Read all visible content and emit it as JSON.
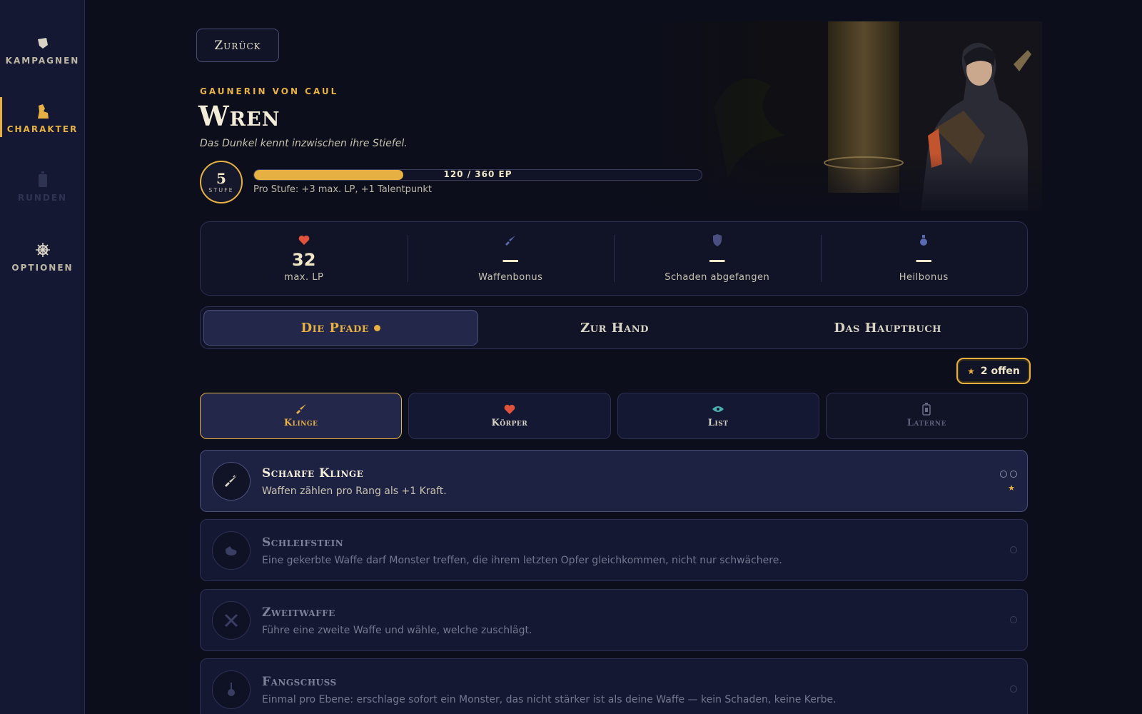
{
  "sidebar": {
    "items": [
      {
        "label": "KAMPAGNEN",
        "icon": "cards-icon"
      },
      {
        "label": "CHARAKTER",
        "icon": "character-icon"
      },
      {
        "label": "RUNDEN",
        "icon": "lantern-icon"
      },
      {
        "label": "OPTIONEN",
        "icon": "wheel-icon"
      }
    ],
    "active": "CHARAKTER"
  },
  "header": {
    "back_label": "Zurück",
    "subtitle": "GAUNERIN VON CAUL",
    "name": "Wren",
    "flavor": "Das Dunkel kennt inzwischen ihre Stiefel.",
    "level": "5",
    "level_label": "STUFE",
    "xp_text": "120 / 360 EP",
    "xp_progress": 0.333,
    "per_level": "Pro Stufe: +3 max. LP, +1 Talentpunkt"
  },
  "stats": [
    {
      "value": "32",
      "label": "max. LP",
      "icon": "heart-icon"
    },
    {
      "value": "—",
      "label": "Waffenbonus",
      "icon": "sword-icon"
    },
    {
      "value": "—",
      "label": "Schaden abgefangen",
      "icon": "shield-icon"
    },
    {
      "value": "—",
      "label": "Heilbonus",
      "icon": "potion-icon"
    }
  ],
  "tabs": [
    {
      "label": "Die Pfade",
      "active": true
    },
    {
      "label": "Zur Hand"
    },
    {
      "label": "Das Hauptbuch"
    }
  ],
  "open_badge": "2 offen",
  "paths": [
    {
      "label": "Klinge",
      "icon": "sword-icon",
      "active": true
    },
    {
      "label": "Körper",
      "icon": "heart-icon"
    },
    {
      "label": "List",
      "icon": "eye-icon"
    },
    {
      "label": "Laterne",
      "icon": "lantern-icon",
      "disabled": true
    }
  ],
  "talents": [
    {
      "name": "Scharfe Klinge",
      "desc": "Waffen zählen pro Rang als +1 Kraft.",
      "icon": "sharp-blade-icon",
      "ranks": 2
    },
    {
      "name": "Schleifstein",
      "desc": "Eine gekerbte Waffe darf Monster treffen, die ihrem letzten Opfer gleichkommen, nicht nur schwächere.",
      "icon": "whetstone-icon",
      "ranks": 1
    },
    {
      "name": "Zweitwaffe",
      "desc": "Führe eine zweite Waffe und wähle, welche zuschlägt.",
      "icon": "crossed-swords-icon",
      "ranks": 1
    },
    {
      "name": "Fangschuss",
      "desc": "Einmal pro Ebene: erschlage sofort ein Monster, das nicht stärker ist als deine Waffe — kein Schaden, keine Kerbe.",
      "icon": "dagger-icon",
      "ranks": 1
    }
  ],
  "colors": {
    "accent": "#e6b042",
    "heart": "#e0523a",
    "eye": "#4ab3b0",
    "background": "#0c0e1b"
  }
}
